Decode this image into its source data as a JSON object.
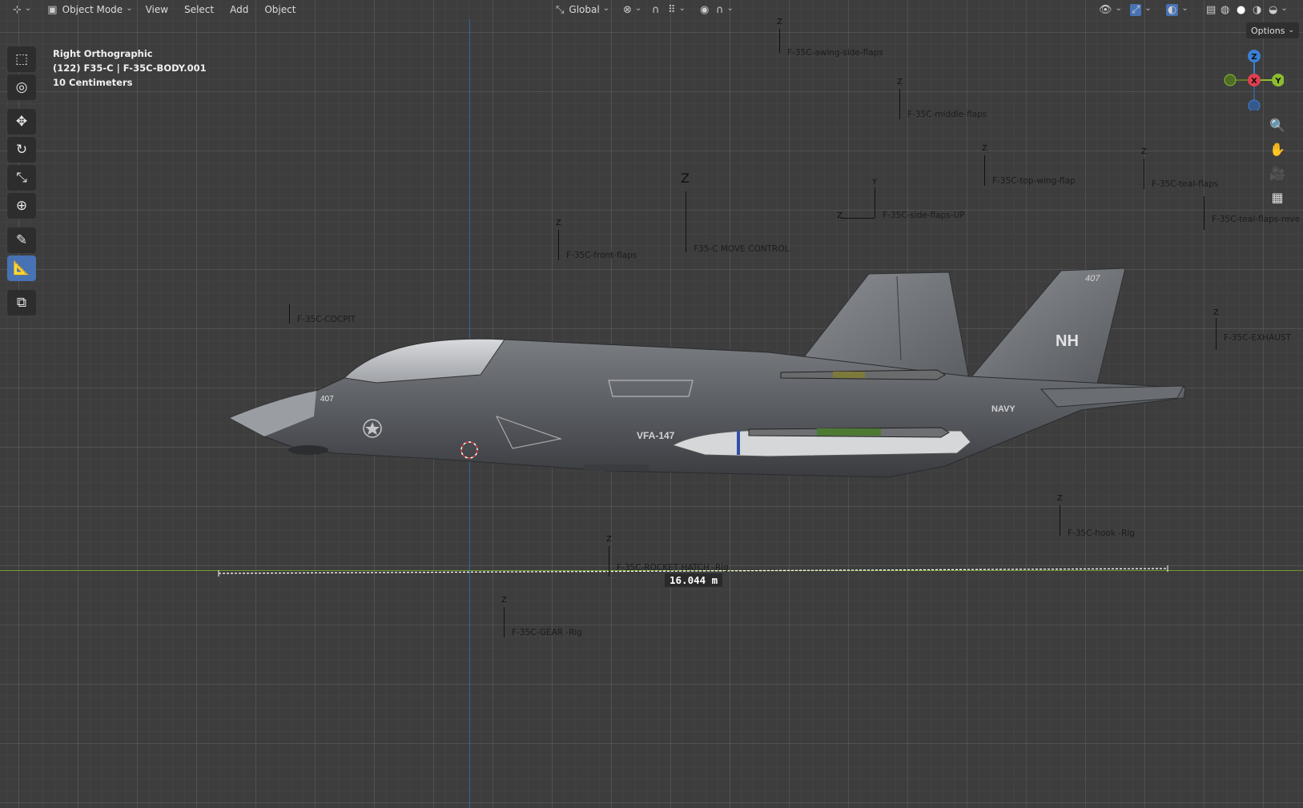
{
  "header": {
    "editor_type_icon": "3d-viewport-icon",
    "mode": "Object Mode",
    "menus": [
      "View",
      "Select",
      "Add",
      "Object"
    ],
    "transform_orientation": "Global"
  },
  "options_label": "Options",
  "overlay": {
    "view_name": "Right Orthographic",
    "object_info": "(122) F35-C | F-35C-BODY.001",
    "grid_scale": "10 Centimeters"
  },
  "gizmo": {
    "z": "Z",
    "x": "X",
    "y": "Y",
    "colors": {
      "x": "#e0404f",
      "y": "#8bbd2f",
      "z": "#3a7fd5"
    }
  },
  "empties": [
    {
      "name": "F-35C-awing-side-flaps",
      "axis": "Z"
    },
    {
      "name": "F-35C-middle-flaps",
      "axis": "Z"
    },
    {
      "name": "F-35C-top-wing-flap",
      "axis": "Z"
    },
    {
      "name": "F-35C-teal-flaps",
      "axis": "Z"
    },
    {
      "name": "F-35C-teal-flaps-reve",
      "axis": ""
    },
    {
      "name": "F-35C-side-flaps-UP",
      "axis": "Y",
      "axis2": "Z"
    },
    {
      "name": "F35-C MOVE CONTROL",
      "axis": "Z"
    },
    {
      "name": "F-35C-front-flaps",
      "axis": "Z"
    },
    {
      "name": "F-35C-COCPIT",
      "axis": ""
    },
    {
      "name": "F-35C-EXHAUST",
      "axis": "Z"
    },
    {
      "name": "F-35C-hook -Rig",
      "axis": "Z"
    },
    {
      "name": "F-35C-ROCKET HATCH -Rig",
      "axis": "Z"
    },
    {
      "name": "F-35C-GEAR -Rig",
      "axis": "Z"
    }
  ],
  "measurement": "16.044 m",
  "aircraft": {
    "nose_number": "407",
    "tail_number": "407",
    "tail_code": "NH",
    "squadron": "VFA-147",
    "service": "NAVY"
  },
  "colors": {
    "background": "#3d3d3d",
    "active_tool": "#4772b3",
    "axis_green": "#6f9a2a",
    "axis_blue": "#3568b5"
  }
}
